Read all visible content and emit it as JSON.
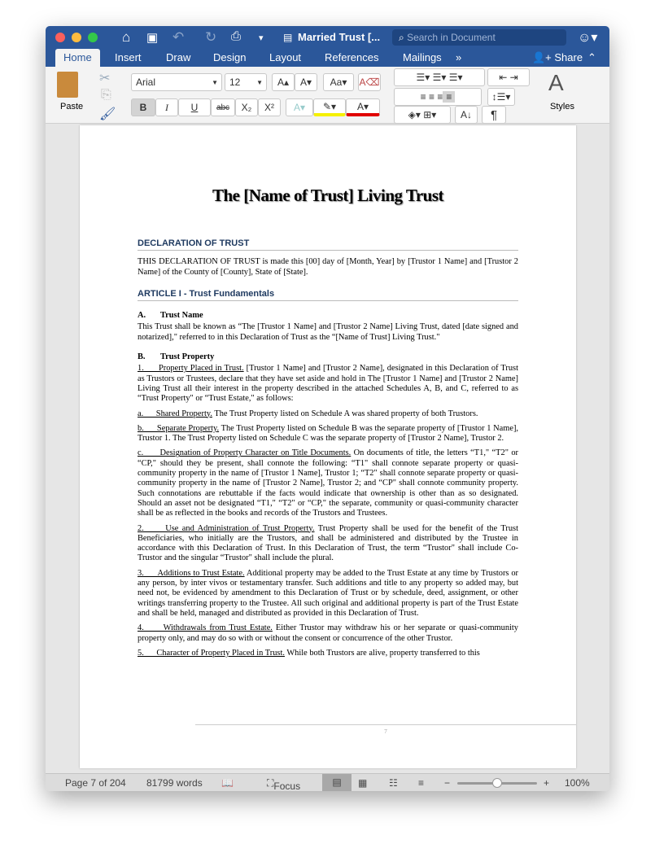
{
  "window": {
    "title": "Married Trust [...",
    "search_placeholder": "Search in Document"
  },
  "tabs": [
    "Home",
    "Insert",
    "Draw",
    "Design",
    "Layout",
    "References",
    "Mailings"
  ],
  "share_label": "Share",
  "ribbon": {
    "paste": "Paste",
    "font": "Arial",
    "size": "12",
    "styles": "Styles",
    "bold": "B",
    "italic": "I",
    "underline": "U",
    "strike": "abc",
    "sub": "X₂",
    "sup": "X²",
    "grow": "A▴",
    "shrink": "A▾",
    "pilcrow": "¶"
  },
  "colors": {
    "accent": "#2b579a",
    "highlight": "#f5f000",
    "font_color": "#e00000"
  },
  "doc": {
    "title": "The [Name of Trust] Living Trust",
    "s1": "DECLARATION OF TRUST",
    "p1": "THIS DECLARATION OF TRUST is made this [00] day of [Month, Year] by [Trustor 1 Name] and [Trustor 2 Name] of the County of [County], State of [State].",
    "s2": "ARTICLE I - Trust Fundamentals",
    "a_num": "A.",
    "a_title": "Trust Name",
    "a_text": "This Trust shall be known as “The [Trustor 1 Name] and [Trustor 2 Name] Living Trust, dated [date signed and notarized],\" referred to in this Declaration of Trust as the “[Name of Trust] Living Trust.\"",
    "b_num": "B.",
    "b_title": "Trust Property",
    "paras": [
      {
        "label": "1.      Property Placed in Trust.",
        "text": " [Trustor 1 Name] and [Trustor 2 Name], designated in this Declaration of Trust as Trustors or Trustees, declare that they have set aside and hold in The [Trustor 1 Name] and [Trustor 2 Name] Living Trust all their interest in the property described in the attached Schedules A, B, and C, referred to as “Trust Property\" or “Trust Estate,\" as follows:"
      },
      {
        "label": "a.      Shared Property.",
        "text": " The Trust Property listed on Schedule A was shared property of both Trustors."
      },
      {
        "label": "b.      Separate Property.",
        "text": " The Trust Property listed on Schedule B was the separate property of [Trustor 1 Name], Trustor 1. The Trust Property listed on Schedule C was the separate property of [Trustor 2 Name], Trustor 2."
      },
      {
        "label": "c.      Designation of Property Character on Title Documents.",
        "text": " On documents of title, the letters “T1,\" “T2\" or “CP,\" should they be present, shall connote the following: “T1\" shall connote separate property or quasi-community property in the name of [Trustor 1 Name], Trustor 1; “T2\" shall connote separate property or quasi-community property in the name of [Trustor 2 Name], Trustor 2; and “CP\" shall connote community property. Such connotations are rebuttable if the facts would indicate that ownership is other than as so designated. Should an asset not be designated “T1,\" “T2\" or “CP,\" the separate, community or quasi-community character shall be as reflected in the books and records of the Trustors and Trustees."
      },
      {
        "label": "2.      Use and Administration of Trust Property.",
        "text": " Trust Property shall be used for the benefit of the Trust Beneficiaries, who initially are the Trustors, and shall be administered and distributed by the Trustee in accordance with this Declaration of Trust. In this Declaration of Trust, the term “Trustor\" shall include Co- Trustor and the singular “Trustor\" shall include the plural."
      },
      {
        "label": "3.      Additions to Trust Estate.",
        "text": " Additional property may be added to the Trust Estate at any time by Trustors or any person, by inter vivos or testamentary transfer. Such additions and title to any property so added may, but need not, be evidenced by amendment to this Declaration of Trust or by schedule, deed, assignment, or other writings transferring property to the Trustee. All such original and additional property is part of the Trust Estate and shall be held, managed and distributed as provided in this Declaration of Trust."
      },
      {
        "label": "4.      Withdrawals from Trust Estate.",
        "text": " Either Trustor may withdraw his or her separate or quasi-community property only, and may do so with or without the consent or concurrence of the other Trustor."
      },
      {
        "label": "5.      Character of Property Placed in Trust.",
        "text": " While both Trustors are alive, property transferred to this"
      }
    ],
    "page_number": "7"
  },
  "status": {
    "page": "Page 7 of 204",
    "words": "81799 words",
    "focus": "Focus",
    "zoom": "100%",
    "zoom_level": 100
  }
}
